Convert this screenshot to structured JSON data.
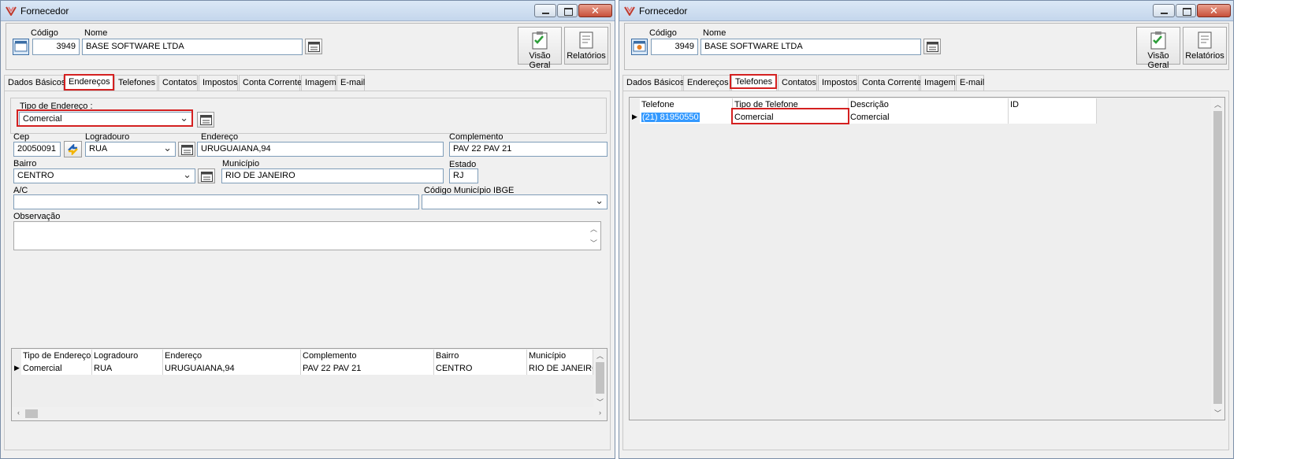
{
  "window_title": "Fornecedor",
  "header": {
    "codigo_label": "Código",
    "codigo_value": "3949",
    "nome_label": "Nome",
    "nome_value": "BASE SOFTWARE LTDA",
    "visao_geral_label": "Visão Geral",
    "relatorios_label": "Relatórios"
  },
  "tabs": [
    "Dados Básicos",
    "Endereços",
    "Telefones",
    "Contatos",
    "Impostos",
    "Conta Corrente",
    "Imagem",
    "E-mail"
  ],
  "left_window": {
    "active_tab": "Endereços",
    "tipo_endereco_label": "Tipo de Endereço :",
    "tipo_endereco_value": "Comercial",
    "cep_label": "Cep",
    "cep_value": "20050091",
    "logradouro_label": "Logradouro",
    "logradouro_value": "RUA",
    "endereco_label": "Endereço",
    "endereco_value": "URUGUAIANA,94",
    "complemento_label": "Complemento",
    "complemento_value": "PAV 22 PAV 21",
    "bairro_label": "Bairro",
    "bairro_value": "CENTRO",
    "municipio_label": "Município",
    "municipio_value": "RIO DE JANEIRO",
    "estado_label": "Estado",
    "estado_value": "RJ",
    "ac_label": "A/C",
    "ac_value": "",
    "ibge_label": "Código Município IBGE",
    "ibge_value": "",
    "observacao_label": "Observação",
    "observacao_value": "",
    "grid": {
      "columns": [
        "Tipo de Endereço",
        "Logradouro",
        "Endereço",
        "Complemento",
        "Bairro",
        "Município"
      ],
      "rows": [
        [
          "Comercial",
          "RUA",
          "URUGUAIANA,94",
          "PAV 22 PAV 21",
          "CENTRO",
          "RIO DE JANEIRO"
        ]
      ]
    }
  },
  "right_window": {
    "active_tab": "Telefones",
    "grid": {
      "columns": [
        "Telefone",
        "Tipo de Telefone",
        "Descrição",
        "ID"
      ],
      "rows": [
        [
          "(21) 81950550",
          "Comercial",
          "Comercial",
          ""
        ]
      ]
    }
  },
  "colors": {
    "highlight": "#d42020",
    "selection": "#3399ff"
  }
}
